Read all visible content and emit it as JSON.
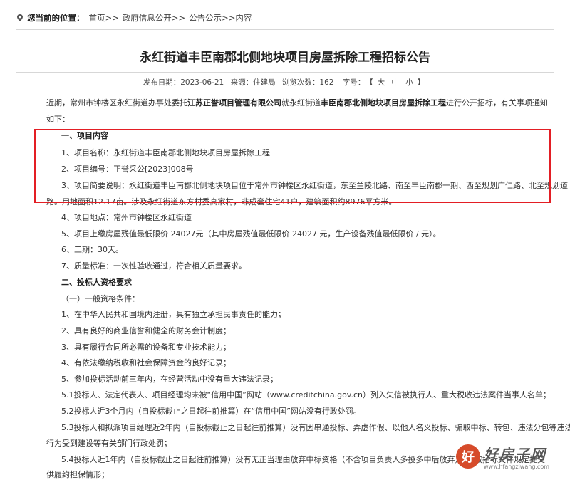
{
  "breadcrumb": {
    "label": "您当前的位置：",
    "items": [
      "首页>>",
      "政府信息公开>>",
      "公告公示>>内容"
    ]
  },
  "title": "永红街道丰臣南郡北侧地块项目房屋拆除工程招标公告",
  "meta": {
    "date": "发布日期：2023-06-21",
    "source": "来源：住建局",
    "views": "浏览次数：162",
    "fontsize_label": "字号：",
    "fontsize_open": "【",
    "fontsize_large": "大",
    "fontsize_medium": "中",
    "fontsize_small": "小",
    "fontsize_close": "】"
  },
  "intro": {
    "p1": "近期，常州市钟楼区永红街道办事处委托",
    "company": "江苏正誉项目管理有限公司",
    "p2": "就永红街道",
    "project": "丰臣南郡北侧地块项目房屋拆除工程",
    "p3": "进行公开招标，有关事项通知如下："
  },
  "lines": [
    "一、项目内容",
    "1、项目名称：永红街道丰臣南郡北侧地块项目房屋拆除工程",
    "2、项目编号：正誉采公[2023]008号",
    "3、项目简要说明：永红街道丰臣南郡北侧地块项目位于常州市钟楼区永红街道，东至兰陵北路、南至丰臣南郡一期、西至规划广仁路、北至规划道",
    "路。用地面积12.17亩。涉及永红街道东方村委高家村，非成套住宅41户，建筑面积约8976平方米。",
    "4、项目地点：常州市钟楼区永红街道",
    "5、项目上缴房屋残值最低限价 24027元（其中房屋残值最低限价 24027 元，生产设备残值最低限价 / 元）。",
    "6、工期：30天。",
    "7、质量标准：一次性验收通过，符合相关质量要求。",
    "二、投标人资格要求",
    "（一）一般资格条件：",
    "1、在中华人民共和国境内注册，具有独立承担民事责任的能力；",
    "2、具有良好的商业信誉和健全的财务会计制度；",
    "3、具有履行合同所必需的设备和专业技术能力；",
    "4、有依法缴纳税收和社会保障资金的良好记录；",
    "5、参加投标活动前三年内，在经营活动中没有重大违法记录；",
    "5.1投标人、法定代表人、项目经理均未被“信用中国”网站（www.creditchina.gov.cn）列入失信被执行人、重大税收违法案件当事人名单；",
    "5.2投标人近3个月内（自投标截止之日起往前推算）在“信用中国”网站没有行政处罚。",
    "5.3投标人和拟派项目经理近2年内（自投标截止之日起往前推算）没有因串通投标、弄虚作假、以他人名义投标、骗取中标、转包、违法分包等违法",
    "行为受到建设等有关部门行政处罚；",
    "5.4投标人近1年内（自投标截止之日起往前推算）没有无正当理由放弃中标资格（不含项目负责人多投多中后放弃）、不按招标文件规定提交",
    "供履约担保情形；"
  ],
  "watermark": {
    "logo": "好",
    "main": "好房子网",
    "url": "www.hfangziwang.com"
  },
  "colors": {
    "highlight_border": "#e31e24",
    "watermark_logo": "#d64b2a"
  }
}
